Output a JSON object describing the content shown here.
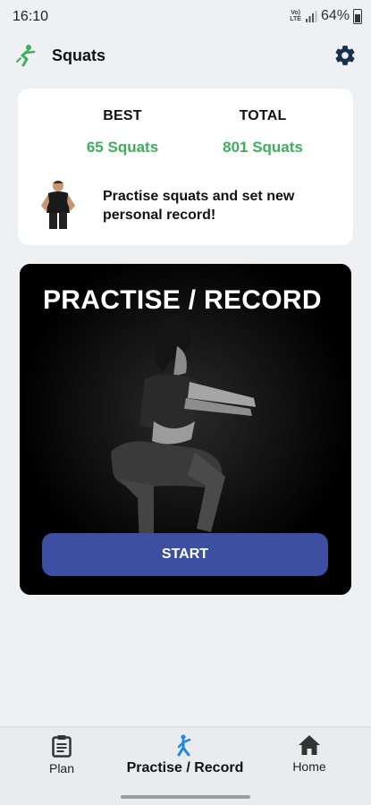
{
  "status_bar": {
    "time": "16:10",
    "network_label": "Vo) LTE",
    "battery": "64%"
  },
  "app_bar": {
    "title": "Squats",
    "logo_icon": "squat-figure-icon",
    "settings_icon": "gear-icon"
  },
  "stats": {
    "best_label": "BEST",
    "best_value": "65 Squats",
    "total_label": "TOTAL",
    "total_value": "801 Squats",
    "motivation": "Practise squats and set new personal record!"
  },
  "practise_card": {
    "heading": "PRACTISE / RECORD",
    "start_label": "START"
  },
  "bottom_nav": {
    "items": [
      {
        "label": "Plan",
        "icon": "clipboard-icon"
      },
      {
        "label": "Practise / Record",
        "icon": "stretching-figure-icon"
      },
      {
        "label": "Home",
        "icon": "home-icon"
      }
    ],
    "active_index": 1
  },
  "colors": {
    "accent_green": "#3fae5b",
    "start_button": "#3d4fa1",
    "active_nav_icon": "#1e88e5",
    "background": "#eef0f3"
  }
}
